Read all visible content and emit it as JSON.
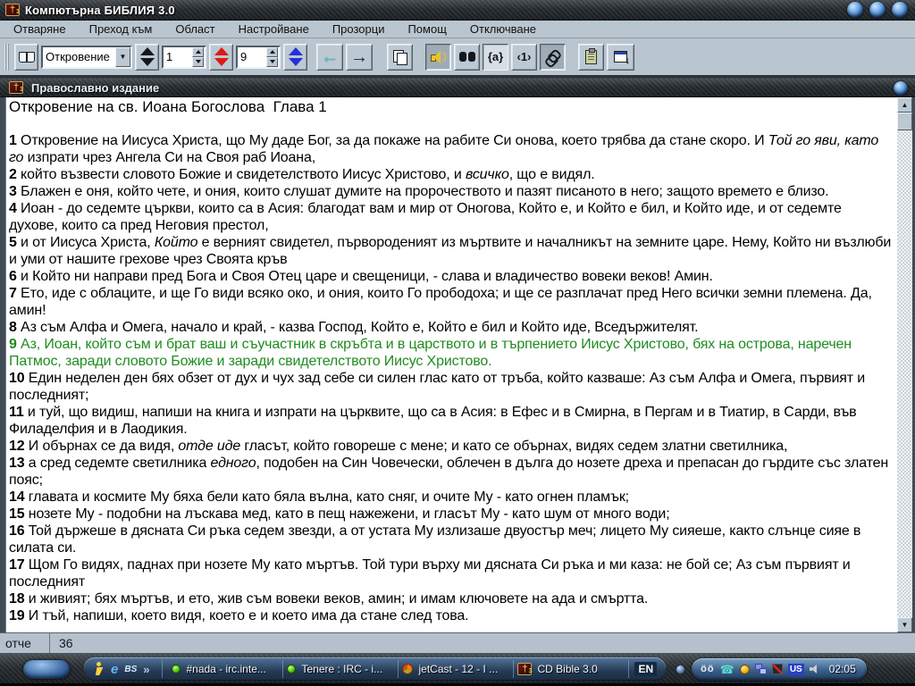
{
  "window": {
    "title": "Компютърна БИБЛИЯ 3.0"
  },
  "menu": {
    "items": [
      "Отваряне",
      "Преход към",
      "Област",
      "Настройване",
      "Прозорци",
      "Помощ",
      "Отключване"
    ]
  },
  "toolbar": {
    "book_dropdown_value": "Откровение",
    "chapter_field": "1",
    "verse_field": "9",
    "brace_a_label": "{a}",
    "angle_one_label": "‹1›"
  },
  "subwindow": {
    "title": "Православно издание"
  },
  "bible": {
    "heading": "Откровение на св. Иоана Богослова  Глава 1",
    "highlight_color": "#1f8c1f",
    "verses": [
      {
        "n": "1",
        "parts": [
          {
            "t": "Откровение на Иисуса Христа, що Му даде Бог, за да покаже на рабите Си онова, което трябва да стане скоро. И "
          },
          {
            "t": "Той го яви, като го",
            "i": true
          },
          {
            "t": " изпрати чрез Ангела Си на Своя раб Иоана,"
          }
        ]
      },
      {
        "n": "2",
        "parts": [
          {
            "t": "който възвести словото Божие и свидетелството Иисус Христово, и "
          },
          {
            "t": "всичко",
            "i": true
          },
          {
            "t": ", що е видял."
          }
        ]
      },
      {
        "n": "3",
        "parts": [
          {
            "t": "Блажен е оня, който чете, и ония, които слушат думите на пророчеството и пазят писаното в него; защото времето е близо."
          }
        ]
      },
      {
        "n": "4",
        "parts": [
          {
            "t": "Иоан - до седемте църкви, които са в Асия: благодат вам и мир от Оногова, Който е, и Който е бил, и Който иде, и от седемте духове, които са пред Неговия престол,"
          }
        ]
      },
      {
        "n": "5",
        "parts": [
          {
            "t": "и от Иисуса Христа, "
          },
          {
            "t": "Който",
            "i": true
          },
          {
            "t": " е верният свидетел, първороденият из мъртвите и началникът на земните царе. Нему, Който ни възлюби и уми от нашите грехове чрез Своята кръв"
          }
        ]
      },
      {
        "n": "6",
        "parts": [
          {
            "t": "и Който ни направи пред Бога и Своя Отец царе и свещеници, - слава и владичество вовеки веков! Амин."
          }
        ]
      },
      {
        "n": "7",
        "parts": [
          {
            "t": "Ето, иде с облаците, и ще Го види всяко око, и ония, които Го прободоха; и ще се разплачат пред Него всички земни племена. Да, амин!"
          }
        ]
      },
      {
        "n": "8",
        "parts": [
          {
            "t": "Аз съм Алфа и Омега, начало и край, - казва Господ, Който е, Който е бил и Който иде, Вседържителят."
          }
        ]
      },
      {
        "n": "9",
        "green": true,
        "parts": [
          {
            "t": "Аз, Иоан, който съм и брат ваш и съучастник в скръбта и в царството и в търпението Иисус Христово, бях на острова, наречен Патмос, заради словото Божие и заради свидетелството Иисус Христово."
          }
        ]
      },
      {
        "n": "10",
        "parts": [
          {
            "t": "Един неделен ден бях обзет от дух и чух зад себе си силен глас като от тръба, който казваше: Аз съм Алфа и Омега, първият и последният;"
          }
        ]
      },
      {
        "n": "11",
        "parts": [
          {
            "t": "и туй, що видиш, напиши на книга и изпрати на църквите, що са в Асия: в Ефес и в Смирна, в Пергам и в Тиатир, в Сарди, във Филаделфия и в Лаодикия."
          }
        ]
      },
      {
        "n": "12",
        "parts": [
          {
            "t": "И обърнах се да видя, "
          },
          {
            "t": "отде иде",
            "i": true
          },
          {
            "t": " гласът, който говореше с мене; и като се обърнах, видях седем златни светилника,"
          }
        ]
      },
      {
        "n": "13",
        "parts": [
          {
            "t": "а сред седемте светилника "
          },
          {
            "t": "едного",
            "i": true
          },
          {
            "t": ", подобен на Син Човечески, облечен в дълга до нозете дреха и препасан до гърдите със златен пояс;"
          }
        ]
      },
      {
        "n": "14",
        "parts": [
          {
            "t": "главата и космите Му бяха бели като бяла вълна, като сняг, и очите Му - като огнен пламък;"
          }
        ]
      },
      {
        "n": "15",
        "parts": [
          {
            "t": "нозете Му - подобни на лъскава мед, като в пещ нажежени, и гласът Му - като шум от много води;"
          }
        ]
      },
      {
        "n": "16",
        "parts": [
          {
            "t": "Той държеше в дясната Си ръка седем звезди, а от устата Му излизаше двуостър меч; лицето Му сияеше, както слънце сияе в силата си."
          }
        ]
      },
      {
        "n": "17",
        "parts": [
          {
            "t": "Щом Го видях, паднах при нозете Му като мъртъв. Той тури върху ми дясната Си ръка и ми каза: не бой се; Аз съм първият и последният"
          }
        ]
      },
      {
        "n": "18",
        "parts": [
          {
            "t": "и живият; бях мъртъв, и ето, жив съм вовеки веков, амин; и имам ключовете на ада и смъртта."
          }
        ]
      },
      {
        "n": "19",
        "parts": [
          {
            "t": "И тъй, напиши, което видя, което е и което има да стане след това."
          }
        ]
      }
    ]
  },
  "statusbar": {
    "left": "отче",
    "right": "36"
  },
  "taskbar": {
    "quick_launch": [
      {
        "name": "aim-icon"
      },
      {
        "name": "ie-icon",
        "glyph": "e"
      },
      {
        "name": "bsplayer-icon",
        "glyph": "BS"
      },
      {
        "name": "overflow-chevron-icon",
        "glyph": "»"
      }
    ],
    "buttons": [
      {
        "label": "#nada - irc.inte...",
        "icon": "mirc-icon"
      },
      {
        "label": "Tenere : IRC - i...",
        "icon": "mirc-icon"
      },
      {
        "label": "jetCast - 12 - I ...",
        "icon": "jetcast-icon"
      },
      {
        "label": "CD Bible 3.0",
        "icon": "bible-icon"
      }
    ],
    "language_indicator": "EN",
    "tray_icons": [
      {
        "name": "eyes-icon",
        "glyph": "öö"
      },
      {
        "name": "dialup-icon",
        "glyph": "☎"
      },
      {
        "name": "icq-icon"
      },
      {
        "name": "network-icon"
      },
      {
        "name": "mute-icon"
      },
      {
        "name": "keyboard-layout-indicator",
        "glyph": "US"
      },
      {
        "name": "volume-icon"
      }
    ],
    "clock": "02:05"
  }
}
